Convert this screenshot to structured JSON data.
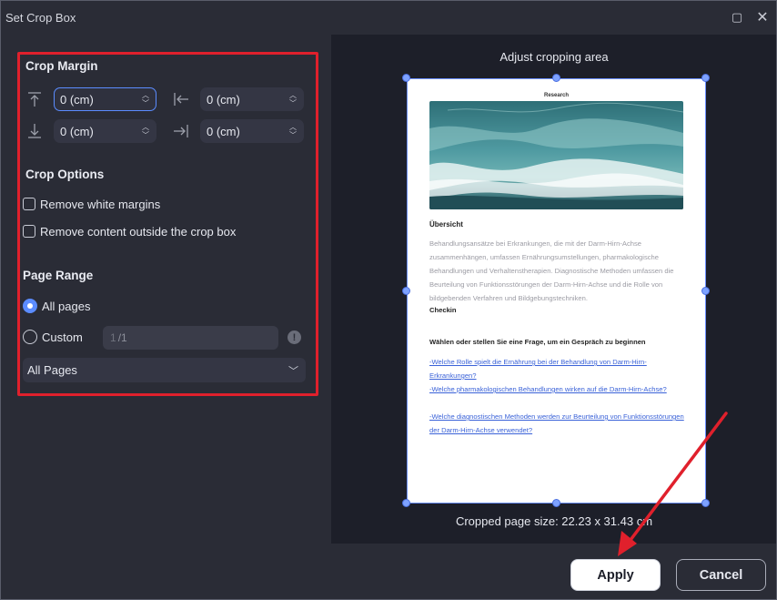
{
  "window": {
    "title": "Set Crop Box",
    "maximize_glyph": "▢",
    "close_glyph": "✕"
  },
  "crop_margin": {
    "title": "Crop Margin",
    "top": "0 (cm)",
    "left": "0 (cm)",
    "bottom": "0 (cm)",
    "right": "0 (cm)"
  },
  "crop_options": {
    "title": "Crop Options",
    "remove_white_margins": {
      "label": "Remove white margins",
      "checked": false
    },
    "remove_outside": {
      "label": "Remove content outside the crop box",
      "checked": false
    }
  },
  "page_range": {
    "title": "Page Range",
    "all_pages_label": "All pages",
    "custom_label": "Custom",
    "custom_value": "1",
    "custom_suffix": "/1",
    "selected": "all",
    "info_glyph": "!",
    "subset_select": "All Pages"
  },
  "preview": {
    "title": "Adjust cropping area",
    "size_label": "Cropped page size: 22.23 x 31.43 cm",
    "page": {
      "header": "Research",
      "heading": "Übersicht",
      "paragraph": "Behandlungsansätze bei Erkrankungen, die mit der Darm-Hirn-Achse zusammenhängen, umfassen Ernährungsumstellungen, pharmakologische Behandlungen und Verhaltenstherapien. Diagnostische Methoden umfassen die Beurteilung von Funktionsstörungen der Darm-Hirn-Achse und die Rolle von bildgebenden Verfahren und Bildgebungstechniken.",
      "checkin": "Checkin",
      "question": "Wählen oder stellen Sie eine Frage, um ein Gespräch zu beginnen",
      "links": [
        "-Welche Rolle spielt die Ernährung bei der Behandlung von Darm-Hirn-Erkrankungen?",
        "-Welche pharmakologischen Behandlungen wirken auf die Darm-Hirn-Achse?",
        "-Welche diagnostischen Methoden werden zur Beurteilung von Funktionsstörungen der Darm-Hirn-Achse verwendet?"
      ]
    }
  },
  "buttons": {
    "apply": "Apply",
    "cancel": "Cancel"
  },
  "colors": {
    "accent": "#5b8cff",
    "highlight": "#e0202c",
    "panel": "#2a2c36",
    "preview_bg": "#1d1f29"
  }
}
